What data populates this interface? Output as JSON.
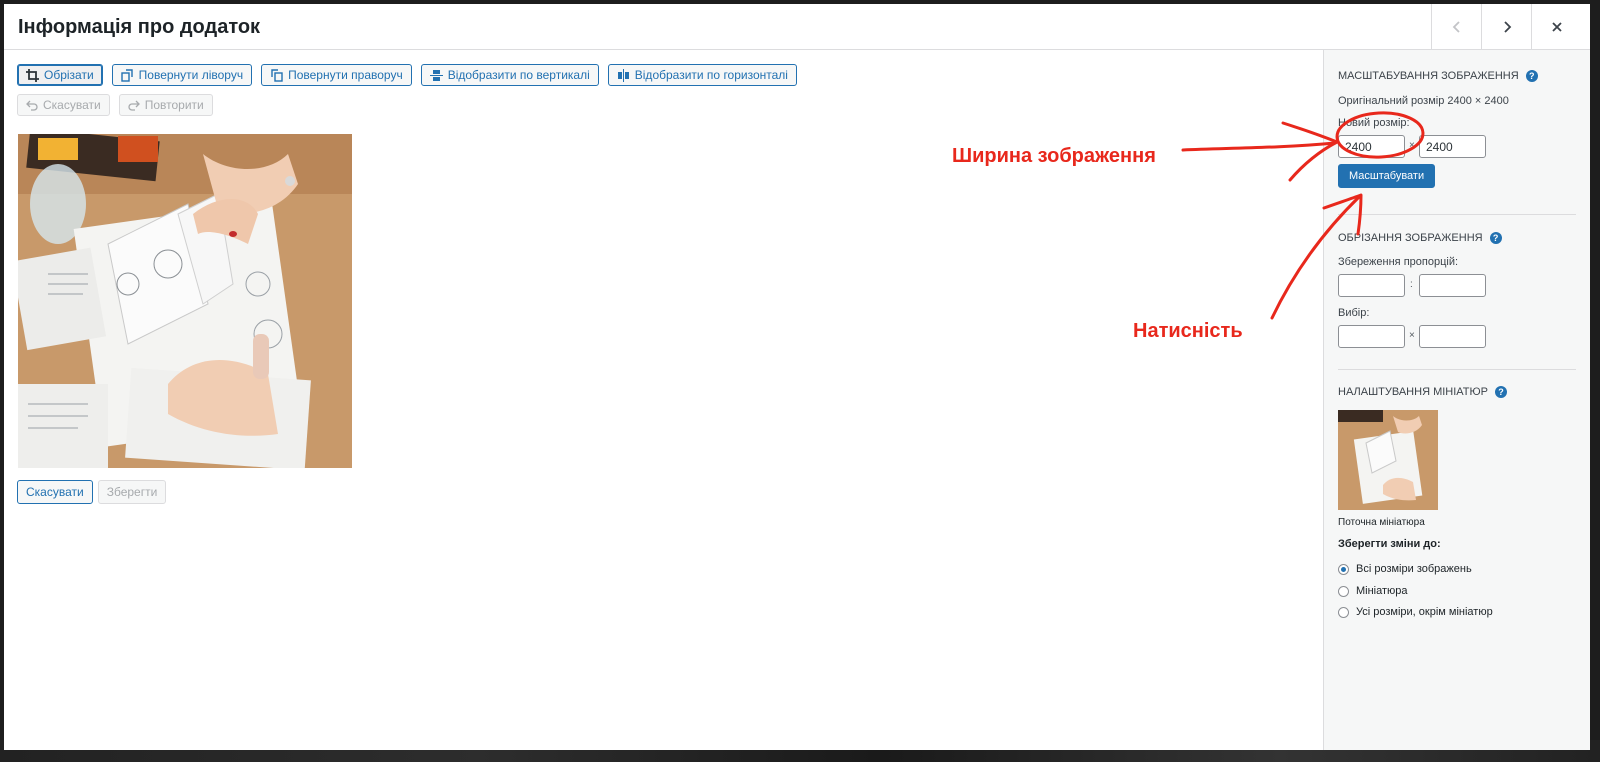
{
  "modal": {
    "title": "Інформація про додаток"
  },
  "toolbar": {
    "crop": "Обрізати",
    "rotate_left": "Повернути ліворуч",
    "rotate_right": "Повернути праворуч",
    "flip_vertical": "Відобразити по вертикалі",
    "flip_horizontal": "Відобразити по горизонталі",
    "undo": "Скасувати",
    "redo": "Повторити"
  },
  "editor_actions": {
    "cancel": "Скасувати",
    "save": "Зберегти"
  },
  "sidebar": {
    "scale": {
      "title": "Масштабування зображення",
      "original_size": "Оригінальний розмір 2400 × 2400",
      "new_size_label": "Новий розмір:",
      "width_value": "2400",
      "height_value": "2400",
      "separator": "×",
      "button": "Масштабувати"
    },
    "crop": {
      "title": "Обрізання зображення",
      "aspect_label": "Збереження пропорцій:",
      "aspect_separator": ":",
      "selection_label": "Вибір:",
      "selection_separator": "×"
    },
    "thumbnail": {
      "title": "Налаштування мініатюр",
      "caption": "Поточна мініатюра",
      "apply_label": "Зберегти зміни до:",
      "options": [
        "Всі розміри зображень",
        "Мініатюра",
        "Усі розміри, окрім мініатюр"
      ],
      "selected_index": 0
    },
    "help_glyph": "?"
  },
  "annotations": {
    "width_label": "Ширина зображення",
    "press_label": "Натисність",
    "color": "#e8281c"
  },
  "colors": {
    "accent": "#2271b1",
    "sidebar_bg": "#f6f7f7",
    "border": "#dcdcde"
  }
}
